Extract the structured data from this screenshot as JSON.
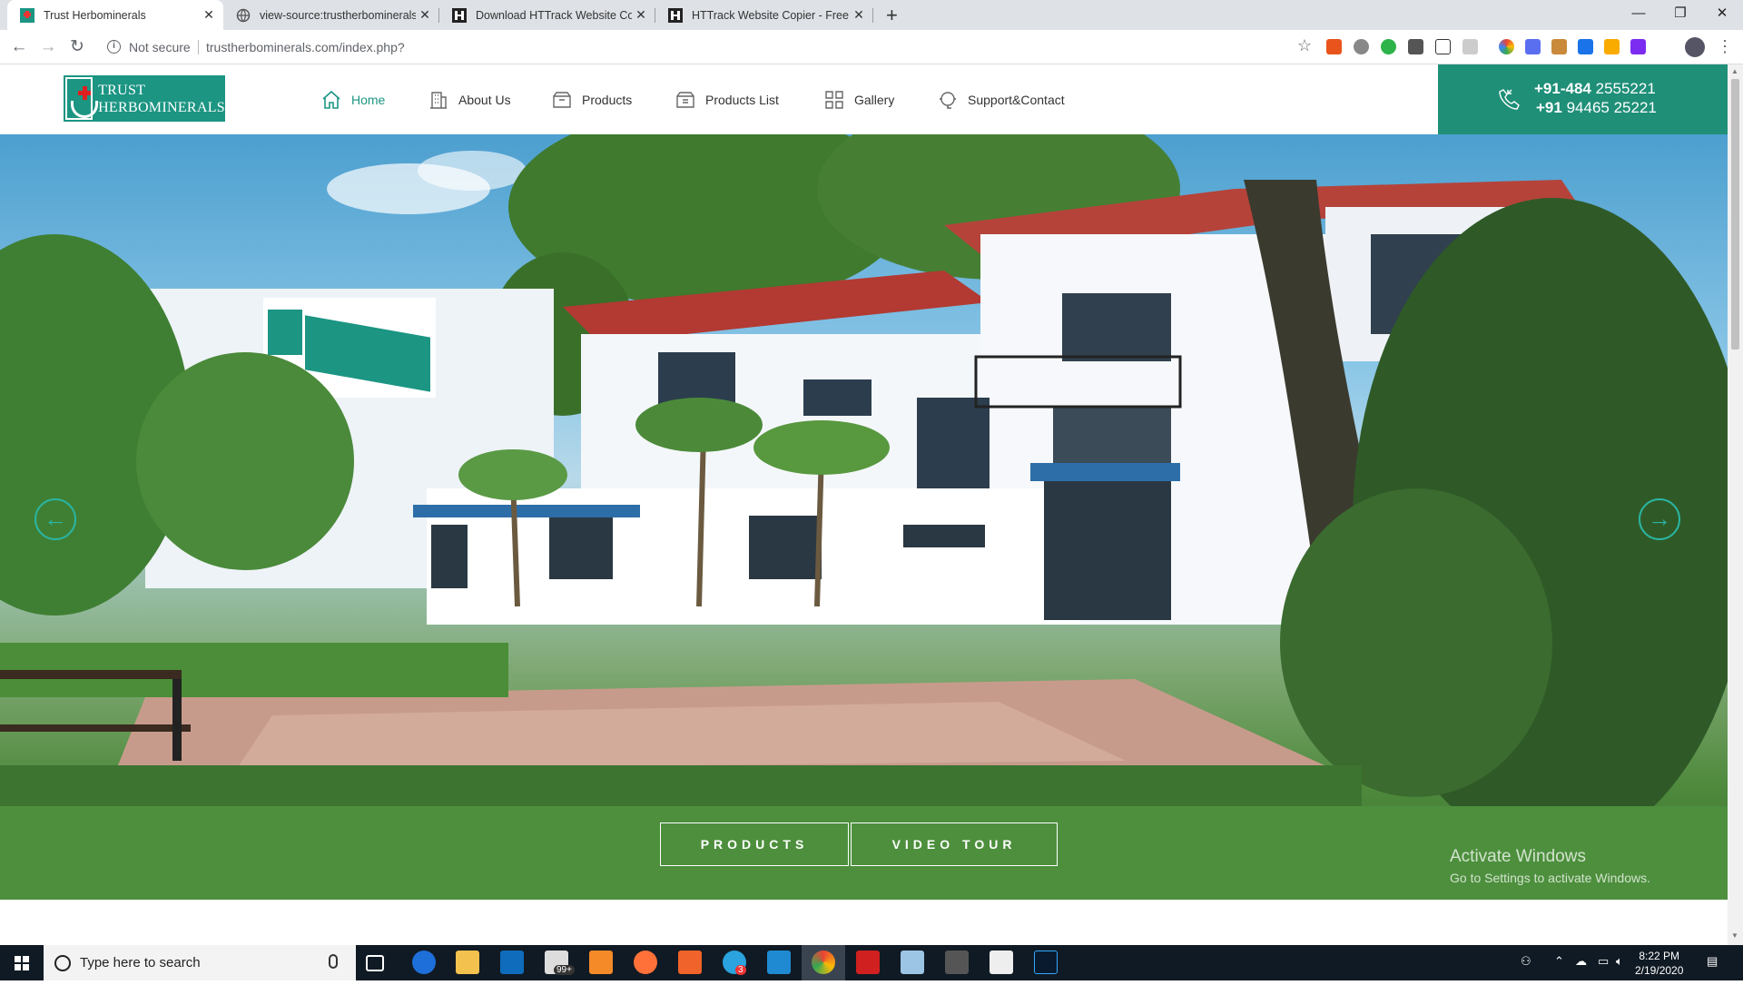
{
  "browser": {
    "tabs": [
      {
        "title": "Trust Herbominerals",
        "active": true
      },
      {
        "title": "view-source:trustherbominerals.c",
        "active": false
      },
      {
        "title": "Download HTTrack Website Copi",
        "active": false
      },
      {
        "title": "HTTrack Website Copier - Free Sc",
        "active": false
      }
    ],
    "security_label": "Not secure",
    "url": "trustherbominerals.com/index.php?"
  },
  "site": {
    "logo_line1": "TRUST",
    "logo_line2": "HERBOMINERALS",
    "nav": [
      {
        "label": "Home",
        "icon": "home-icon",
        "active": true
      },
      {
        "label": "About Us",
        "icon": "building-icon"
      },
      {
        "label": "Products",
        "icon": "package-icon"
      },
      {
        "label": "Products List",
        "icon": "package-list-icon"
      },
      {
        "label": "Gallery",
        "icon": "grid-icon"
      },
      {
        "label": "Support&Contact",
        "icon": "support-icon"
      }
    ],
    "phone1_prefix": "+91-484",
    "phone1_number": "2555221",
    "phone2_prefix": "+91",
    "phone2_number": "94465 25221",
    "accent_color": "#1c9583",
    "hero": {
      "prev_icon": "arrow-left-icon",
      "next_icon": "arrow-right-icon",
      "cta_products": "PRODUCTS",
      "cta_video": "VIDEO TOUR"
    }
  },
  "windows": {
    "watermark_title": "Activate Windows",
    "watermark_sub": "Go to Settings to activate Windows.",
    "search_placeholder": "Type here to search",
    "mail_badge": "99+",
    "telegram_badge": "3",
    "time": "8:22 PM",
    "date": "2/19/2020"
  }
}
